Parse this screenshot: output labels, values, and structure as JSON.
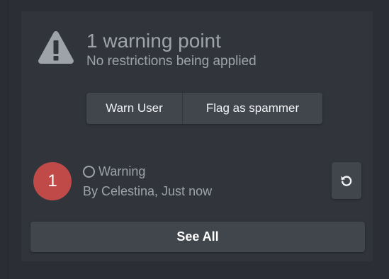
{
  "warning": {
    "title": "1 warning point",
    "subtitle": "No restrictions being applied",
    "icon": "warning-triangle-icon"
  },
  "actions": {
    "warn_user_label": "Warn User",
    "flag_spammer_label": "Flag as spammer"
  },
  "entry": {
    "points": "1",
    "type_label": "Warning",
    "meta": "By Celestina, Just now",
    "status_icon": "circle-outline-icon",
    "undo_icon": "undo-icon",
    "badge_color": "#c04a47"
  },
  "footer": {
    "see_all_label": "See All"
  },
  "colors": {
    "background": "#2b2f35",
    "panel": "#31353b",
    "button": "#41454c",
    "muted_text": "#9ea3aa"
  }
}
